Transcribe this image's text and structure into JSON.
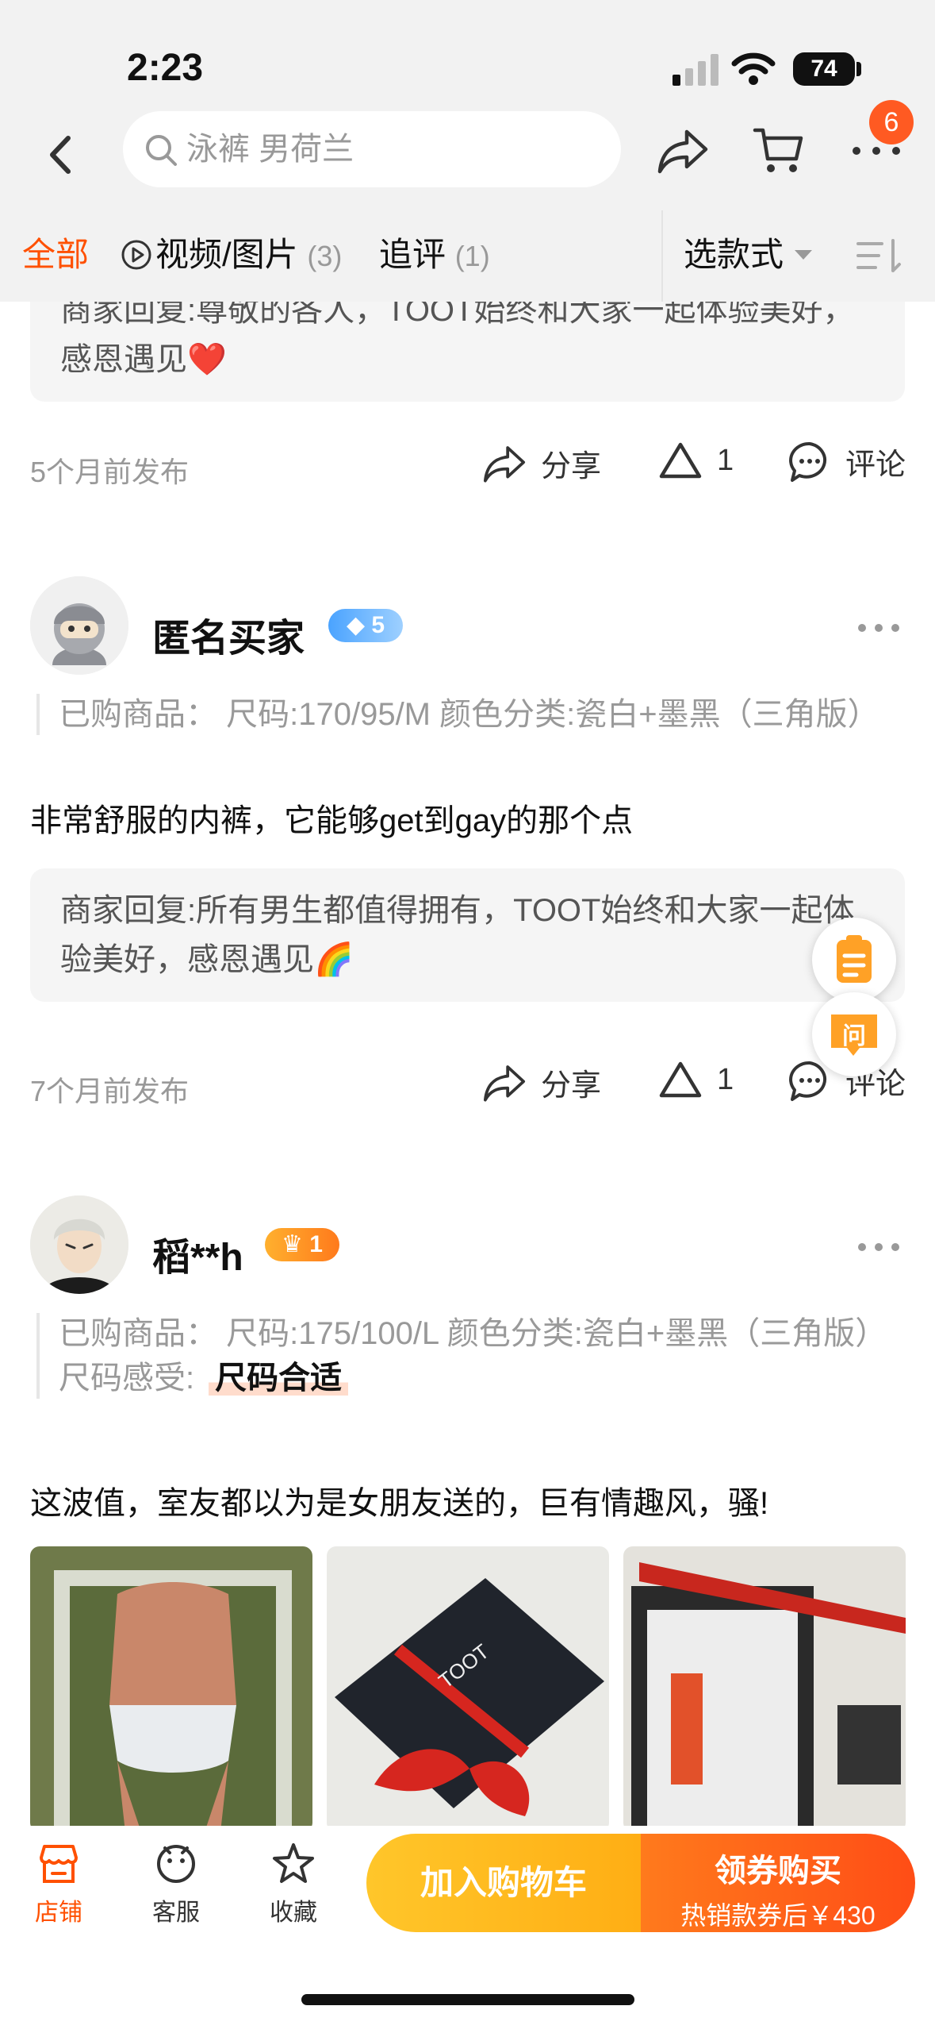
{
  "status_bar": {
    "time": "2:23",
    "battery": "74"
  },
  "header": {
    "search_placeholder": "泳裤 男荷兰",
    "cart_badge": "6"
  },
  "filters": {
    "all": "全部",
    "video_label": "视频/图片",
    "video_count": "(3)",
    "follow_label": "追评",
    "follow_count": "(1)",
    "style_select": "选款式"
  },
  "reviews": [
    {
      "reply_partial": "商家回复:尊敬的各人，TOOT始终和大家一起体验美好，感恩遇见",
      "reply_emoji": "❤️",
      "time": "5个月前发布",
      "share": "分享",
      "likes": "1",
      "comment": "评论"
    },
    {
      "username": "匿名买家",
      "level": "5",
      "purchase": "已购商品：  尺码:170/95/M    颜色分类:瓷白+墨黑（三角版）",
      "content": "非常舒服的内裤，它能够get到gay的那个点",
      "reply": "商家回复:所有男生都值得拥有，TOOT始终和大家一起体验美好，感恩遇见",
      "reply_emoji": "🌈",
      "time": "7个月前发布",
      "share": "分享",
      "likes": "1",
      "comment": "评论"
    },
    {
      "username": "稻**h",
      "level": "1",
      "purchase": "已购商品：  尺码:175/100/L    颜色分类:瓷白+墨黑（三角版）",
      "size_feel_label": "尺码感受:",
      "size_feel_value": "尺码合适",
      "content": "这波值，室友都以为是女朋友送的，巨有情趣风，骚!"
    }
  ],
  "float_ask": "问",
  "bottom": {
    "shop": "店铺",
    "service": "客服",
    "favorite": "收藏",
    "add_cart": "加入购物车",
    "buy": "领券购买",
    "buy_sub": "热销款券后￥430"
  },
  "colors": {
    "accent": "#ff5000",
    "cart_btn": "#ffb41c",
    "buy_btn": "#ff5a18"
  }
}
